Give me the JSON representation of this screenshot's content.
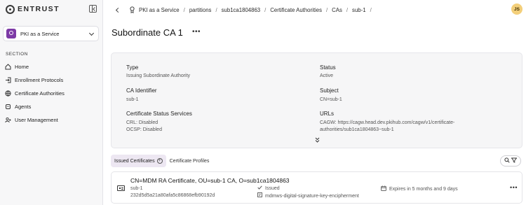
{
  "sidebar": {
    "logo_text": "ENTRUST",
    "product": "PKI as a Service",
    "section_label": "SECTION",
    "items": [
      {
        "label": "Home",
        "icon": "home-icon"
      },
      {
        "label": "Enrollment Protocols",
        "icon": "arrow-into-box-icon"
      },
      {
        "label": "Certificate Authorities",
        "icon": "globe-icon"
      },
      {
        "label": "Agents",
        "icon": "agent-icon"
      },
      {
        "label": "User Management",
        "icon": "users-icon"
      }
    ]
  },
  "breadcrumb": [
    "PKI as a Service",
    "partitions",
    "sub1ca1804863",
    "Certificate Authorities",
    "CAs",
    "sub-1"
  ],
  "user": {
    "initials": "JS"
  },
  "page": {
    "title": "Subordinate CA 1",
    "more": "•••"
  },
  "details": {
    "type_label": "Type",
    "type_value": "Issuing Subordinate Authority",
    "status_label": "Status",
    "status_value": "Active",
    "ca_id_label": "CA Identifier",
    "ca_id_value": "sub-1",
    "subject_label": "Subject",
    "subject_value": "CN=sub-1",
    "css_label": "Certificate Status Services",
    "crl": "CRL: Disabled",
    "ocsp": "OCSP: Disabled",
    "urls_label": "URLs",
    "url_line1": "CAGW: https://cagw.head.dev.pkihub.com/cagw/v1/certificate-",
    "url_line2": "authorities/sub1ca1804863~sub-1",
    "expand": "⌄⌄"
  },
  "tabs": [
    {
      "label": "Issued Certificates",
      "active": true
    },
    {
      "label": "Certificate Profiles",
      "active": false
    }
  ],
  "certificates": [
    {
      "title": "CN=MDM RA Certificate, OU=sub-1 CA, O=sub1ca1804863",
      "ca": "sub-1",
      "serial": "232d5d5a21a80afa5c86868efb90192d",
      "status": "Issued",
      "profile": "mdmws-digital-signature-key-encipherment",
      "expiry": "Expires in 5 months and 9 days",
      "more": "•••"
    }
  ]
}
